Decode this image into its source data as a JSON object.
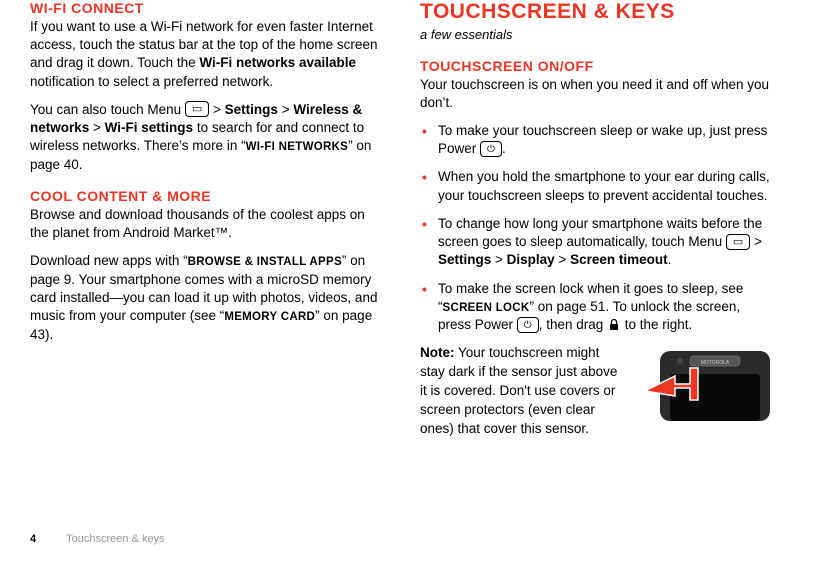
{
  "left": {
    "wifi_heading": "WI-FI CONNECT",
    "wifi_para1_a": "If you want to use a Wi-Fi network for even faster Internet access, touch the status bar at the top of the home screen and drag it down. Touch the ",
    "wifi_para1_b": "Wi-Fi networks available",
    "wifi_para1_c": " notification to select a preferred network.",
    "wifi_para2_a": "You can also touch Menu ",
    "wifi_para2_b": " > ",
    "wifi_settings": "Settings",
    "wifi_wn": "Wireless & networks",
    "wifi_ws": "Wi-Fi settings",
    "wifi_para2_c": " to search for and connect to wireless networks. There’s more in “",
    "wifi_ref": "WI-FI NETWORKS",
    "wifi_para2_d": "” on page 40.",
    "cool_heading": "COOL CONTENT & MORE",
    "cool_para1": "Browse and download thousands of the coolest apps on the planet from Android Market™.",
    "cool_para2_a": "Download new apps with “",
    "cool_ref1": "BROWSE & INSTALL APPS",
    "cool_para2_b": "” on page 9. Your smartphone comes with a microSD memory card installed—you can load it up with photos, videos, and music from your computer (see “",
    "cool_ref2": "MEMORY CARD",
    "cool_para2_c": "” on page 43)."
  },
  "right": {
    "main_heading": "TOUCHSCREEN & KEYS",
    "subtitle": "a few essentials",
    "onoff_heading": "TOUCHSCREEN ON/OFF",
    "onoff_intro": "Your touchscreen is on when you need it and off when you don’t.",
    "b1_a": "To make your touchscreen sleep or wake up, just press Power ",
    "b1_b": ".",
    "b2": "When you hold the smartphone to your ear during calls, your touchscreen sleeps to prevent accidental touches.",
    "b3_a": "To change how long your smartphone waits before the screen goes to sleep automatically, touch Menu ",
    "b3_b": " > ",
    "b3_settings": "Settings",
    "b3_display": "Display",
    "b3_timeout": "Screen timeout",
    "b3_c": ".",
    "b4_a": "To make the screen lock when it goes to sleep, see “",
    "b4_ref": "SCREEN LOCK",
    "b4_b": "” on page 51. To unlock the screen, press Power ",
    "b4_c": ", then drag ",
    "b4_d": " to the right.",
    "note_label": "Note:",
    "note_text": " Your touchscreen might stay dark if the sensor just above it is covered. Don't use covers or screen protectors (even clear ones) that cover this sensor."
  },
  "footer": {
    "page": "4",
    "section": "Touchscreen & keys"
  }
}
